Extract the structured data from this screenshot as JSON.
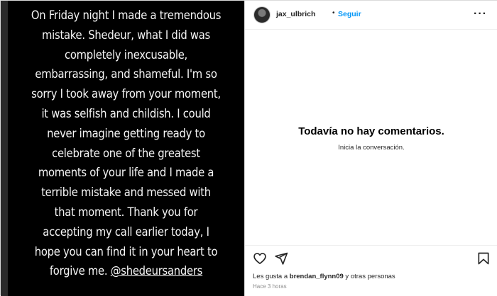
{
  "story": {
    "lines": [
      "On Friday night I made a tremendous",
      "mistake. Shedeur, what I did was",
      "completely inexcusable,",
      "embarrassing, and shameful. I'm so",
      "sorry I took away from your moment,",
      "it was selfish and childish. I could",
      "never imagine getting ready to",
      "celebrate one of the greatest",
      "moments of your life and I made a",
      "terrible mistake and messed with",
      "that moment. Thank you for",
      "accepting my call earlier today, I",
      "hope you can find it in your heart to"
    ],
    "last_line_text": "forgive me. ",
    "mention": "@shedeursanders"
  },
  "header": {
    "username": "jax_ulbrich",
    "separator": "•",
    "follow_label": "Seguir",
    "more_label": "···",
    "more_icon": "more-options-icon"
  },
  "comments": {
    "empty_title": "Todavía no hay comentarios.",
    "empty_subtitle": "Inicia la conversación."
  },
  "actions": {
    "icons": [
      "heart-icon",
      "share-icon",
      "bookmark-icon"
    ]
  },
  "likes": {
    "prefix": "Les gusta a ",
    "user": "brendan_flynn09",
    "suffix": " y otras personas"
  },
  "timestamp": "Hace 3 horas",
  "colors": {
    "accent": "#0095f6",
    "media_bg": "#000000",
    "story_text": "#f5f5f5"
  }
}
